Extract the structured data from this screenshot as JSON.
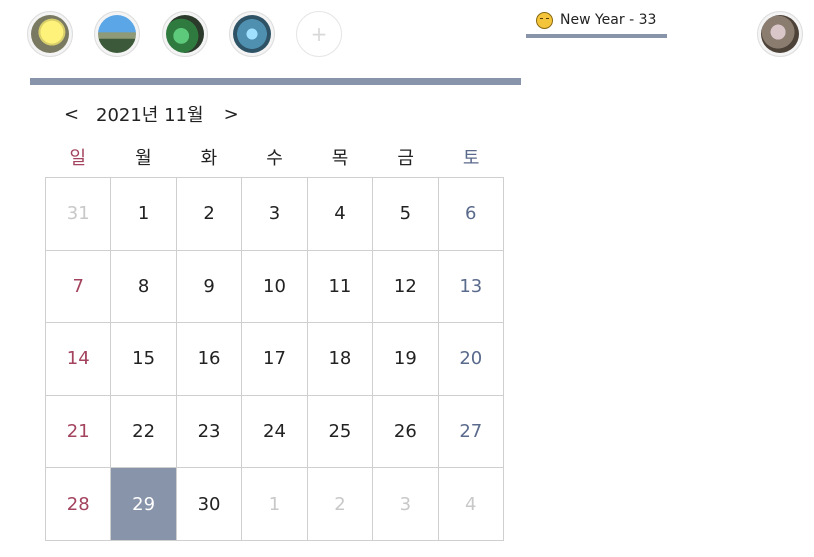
{
  "event": {
    "label": "New Year - 33",
    "icon": "smiley-emoji-icon"
  },
  "stories": [
    {
      "name": "avatar-1"
    },
    {
      "name": "avatar-2"
    },
    {
      "name": "avatar-3"
    },
    {
      "name": "avatar-4"
    }
  ],
  "add_label": "+",
  "calendar": {
    "prev": "<",
    "next": ">",
    "month_label": "2021년 11월",
    "weekdays": [
      "일",
      "월",
      "화",
      "수",
      "목",
      "금",
      "토"
    ],
    "weeks": [
      [
        "31",
        "1",
        "2",
        "3",
        "4",
        "5",
        "6"
      ],
      [
        "7",
        "8",
        "9",
        "10",
        "11",
        "12",
        "13"
      ],
      [
        "14",
        "15",
        "16",
        "17",
        "18",
        "19",
        "20"
      ],
      [
        "21",
        "22",
        "23",
        "24",
        "25",
        "26",
        "27"
      ],
      [
        "28",
        "29",
        "30",
        "1",
        "2",
        "3",
        "4"
      ]
    ],
    "selected_day": "29"
  },
  "colors": {
    "accent": "#8894aa",
    "sunday": "#a3435e",
    "saturday": "#5a6a8c",
    "muted": "#c8c8c8"
  }
}
